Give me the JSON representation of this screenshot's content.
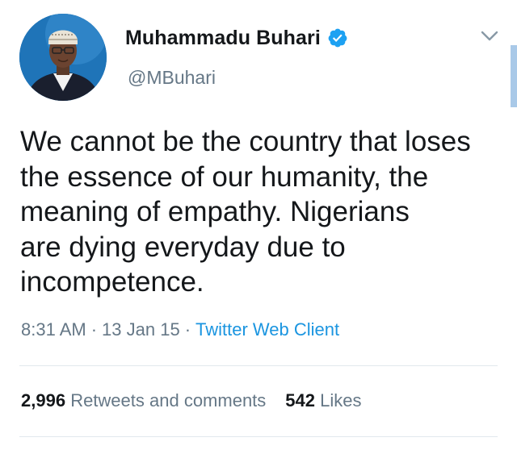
{
  "author": {
    "name": "Muhammadu Buhari",
    "handle": "@MBuhari",
    "verified": true
  },
  "tweet": {
    "lines": [
      "We cannot be the country that loses",
      "the essence of our humanity, the",
      "meaning of empathy. Nigerians",
      "are dying everyday due to",
      "incompetence."
    ]
  },
  "meta": {
    "time": "8:31 AM",
    "date": "13 Jan 15",
    "separator": "·",
    "client": "Twitter Web Client"
  },
  "stats": {
    "retweets_count": "2,996",
    "retweets_label": "Retweets and comments",
    "likes_count": "542",
    "likes_label": "Likes"
  },
  "colors": {
    "text": "#14171a",
    "secondary": "#657786",
    "link": "#1b95e0",
    "divider": "#e1e8ed",
    "verified": "#1da1f2"
  },
  "icons": {
    "verified": "verified-badge-icon",
    "menu": "chevron-down-icon"
  }
}
